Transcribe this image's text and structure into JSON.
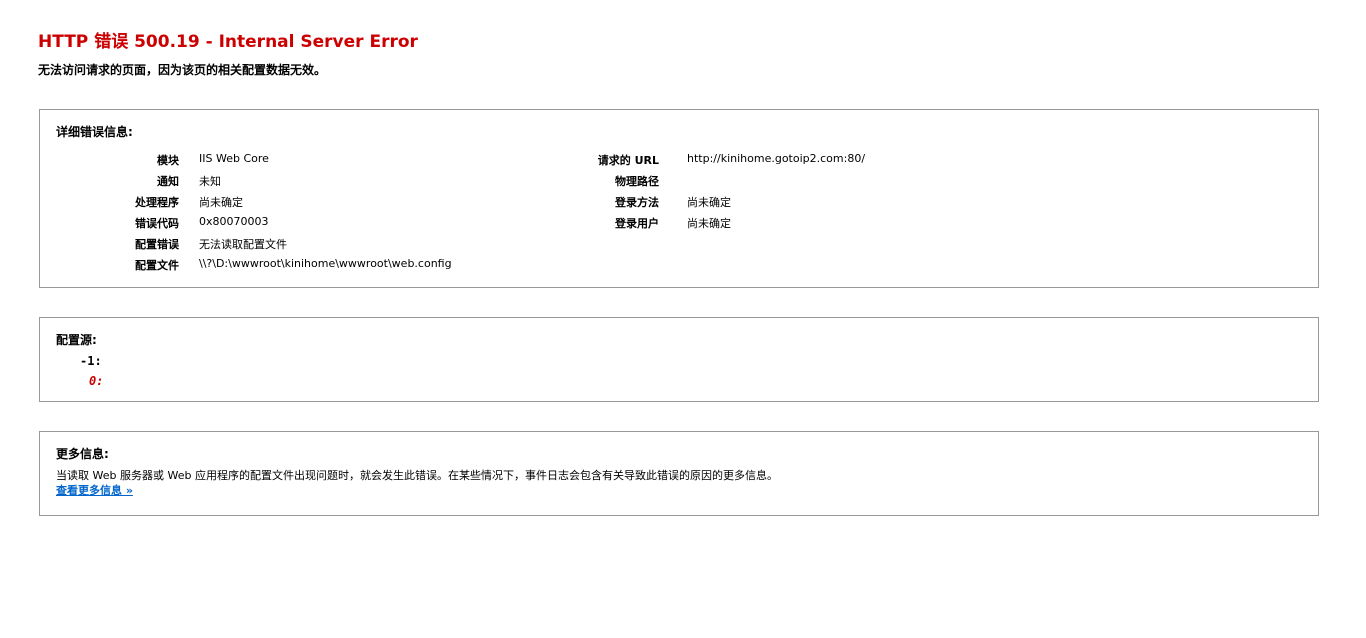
{
  "header": {
    "title": "HTTP 错误 500.19 - Internal Server Error",
    "subtitle": "无法访问请求的页面，因为该页的相关配置数据无效。"
  },
  "detail": {
    "title": "详细错误信息:",
    "left": [
      {
        "label": "模块",
        "value": "IIS Web Core"
      },
      {
        "label": "通知",
        "value": "未知"
      },
      {
        "label": "处理程序",
        "value": "尚未确定"
      },
      {
        "label": "错误代码",
        "value": "0x80070003"
      },
      {
        "label": "配置错误",
        "value": "无法读取配置文件"
      },
      {
        "label": "配置文件",
        "value": "\\\\?\\D:\\wwwroot\\kinihome\\wwwroot\\web.config"
      }
    ],
    "right": [
      {
        "label": "请求的 URL",
        "value": "http://kinihome.gotoip2.com:80/"
      },
      {
        "label": "物理路径",
        "value": ""
      },
      {
        "label": "登录方法",
        "value": "尚未确定"
      },
      {
        "label": "登录用户",
        "value": "尚未确定"
      }
    ]
  },
  "source": {
    "title": "配置源:",
    "lines": [
      {
        "text": "-1:"
      },
      {
        "text": "0:"
      }
    ]
  },
  "more": {
    "title": "更多信息:",
    "text": "当读取 Web 服务器或 Web 应用程序的配置文件出现问题时，就会发生此错误。在某些情况下，事件日志会包含有关导致此错误的原因的更多信息。",
    "link": "查看更多信息 »"
  }
}
